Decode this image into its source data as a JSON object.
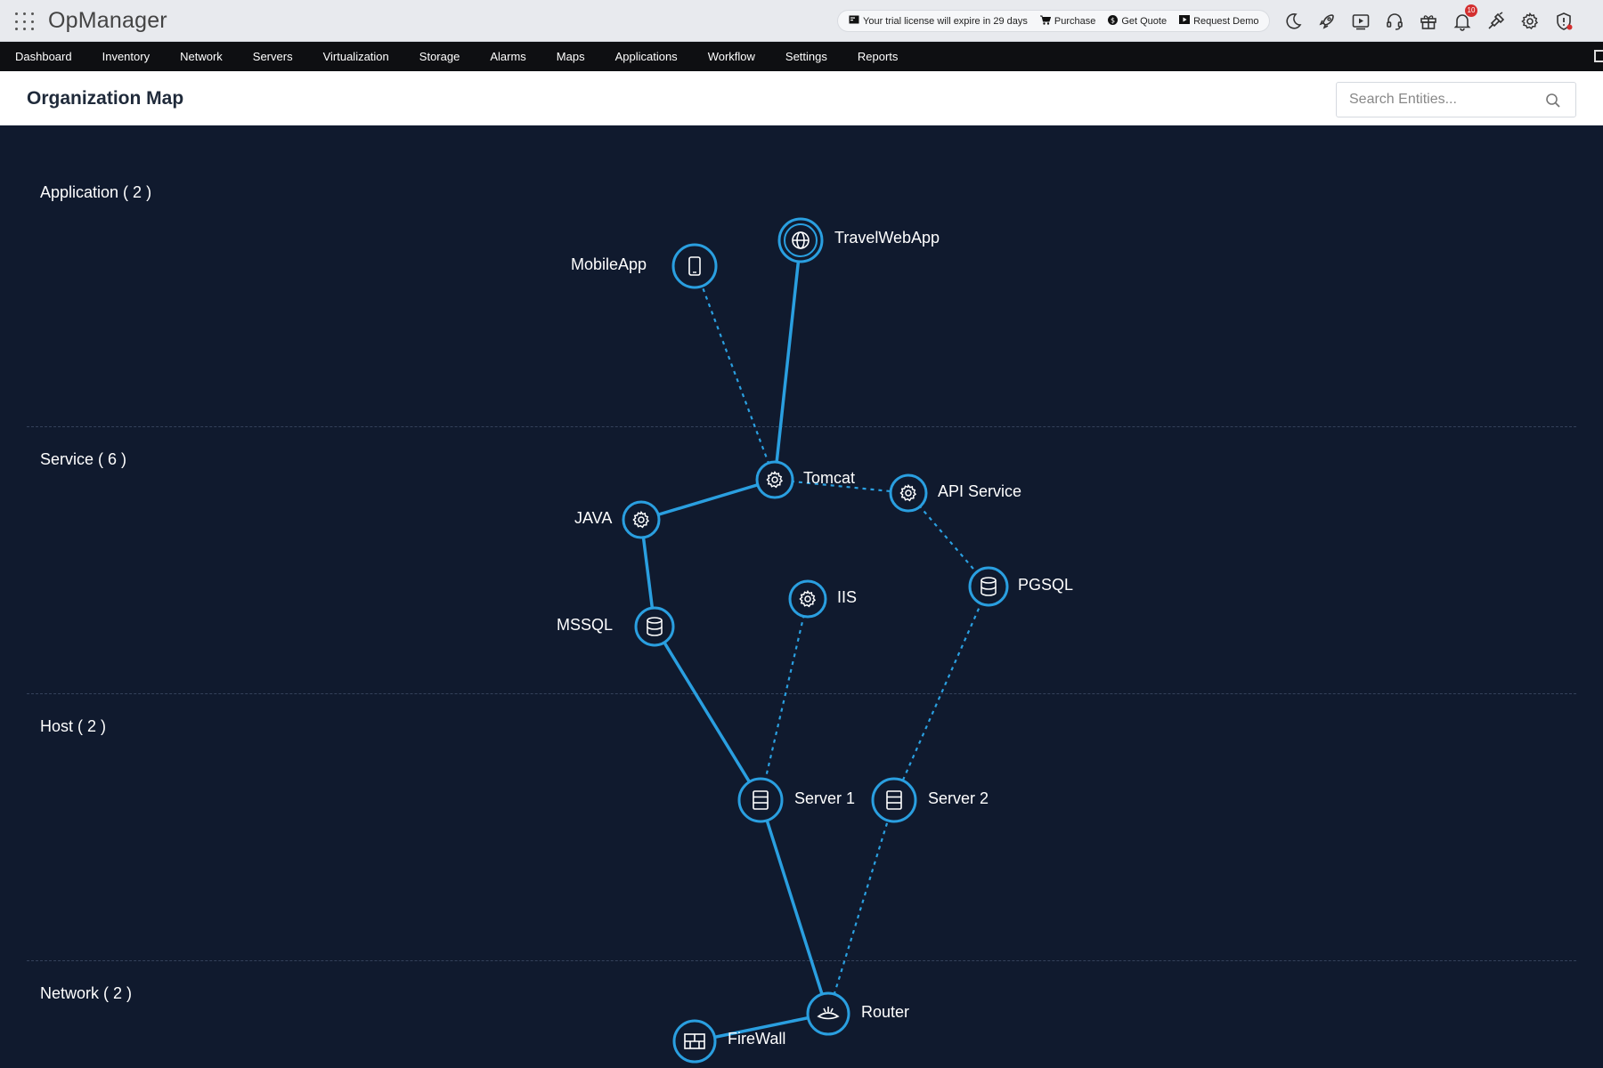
{
  "topbar": {
    "brand": "OpManager",
    "trial_text": "Your trial license will expire in 29 days",
    "purchase_label": "Purchase",
    "quote_label": "Get Quote",
    "demo_label": "Request Demo",
    "notification_count": "10"
  },
  "nav": {
    "items": [
      "Dashboard",
      "Inventory",
      "Network",
      "Servers",
      "Virtualization",
      "Storage",
      "Alarms",
      "Maps",
      "Applications",
      "Workflow",
      "Settings",
      "Reports"
    ]
  },
  "page": {
    "title": "Organization Map",
    "search_placeholder": "Search Entities..."
  },
  "map": {
    "layers": [
      "Application ( 2 )",
      "Service ( 6 )",
      "Host ( 2 )",
      "Network ( 2 )"
    ],
    "nodes": {
      "travelwebapp": "TravelWebApp",
      "mobileapp": "MobileApp",
      "tomcat": "Tomcat",
      "apiservice": "API Service",
      "java": "JAVA",
      "pgsql": "PGSQL",
      "iis": "IIS",
      "mssql": "MSSQL",
      "server1": "Server 1",
      "server2": "Server 2",
      "router": "Router",
      "firewall": "FireWall"
    },
    "colors": {
      "background": "#101a2e",
      "link": "#2a9fe0",
      "node_ring": "#2a9fe0"
    }
  }
}
